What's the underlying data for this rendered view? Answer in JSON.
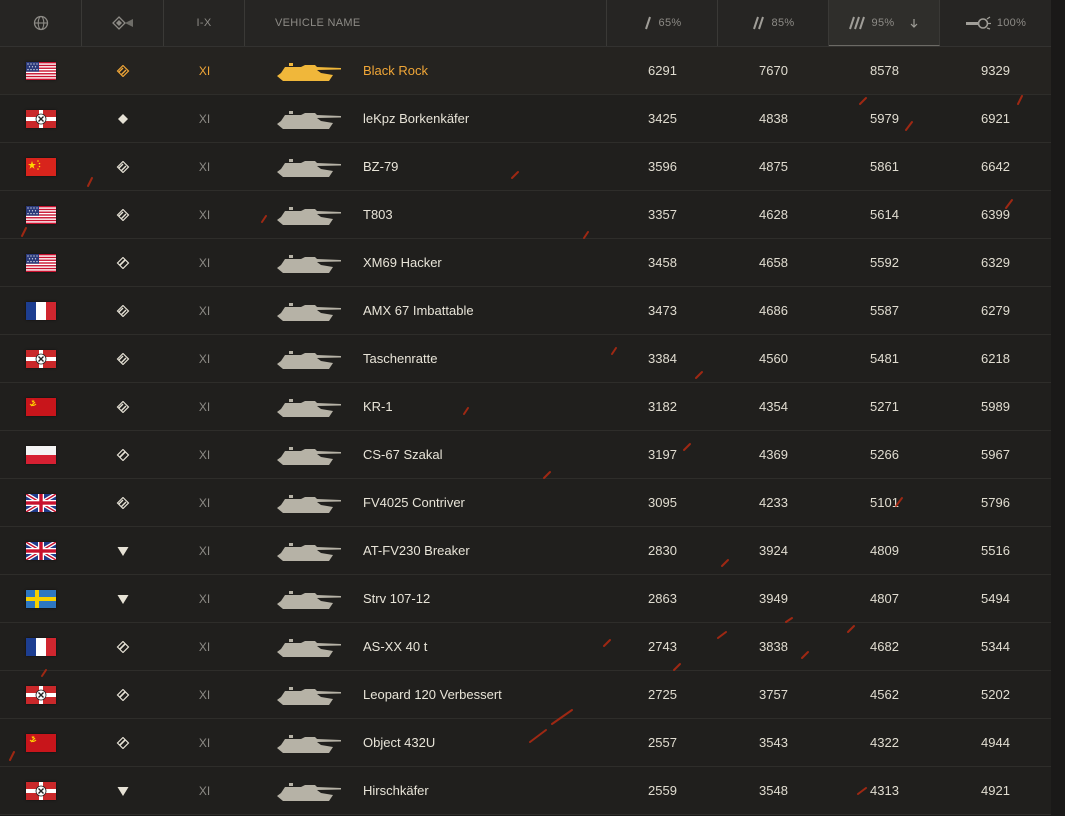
{
  "header": {
    "col_nation": "nation-globe-icon",
    "col_class": "vehicle-class-icon",
    "col_tier": "I-X",
    "col_name": "VEHICLE NAME",
    "col_m1": "65%",
    "col_m2": "85%",
    "col_m3": "95%",
    "col_m3_sort": "sort-down-arrow-icon",
    "col_m4": "100%"
  },
  "colors": {
    "accent": "#f0a637",
    "text": "#e8e4d8",
    "muted": "#8d8b86",
    "background": "#1a1918"
  },
  "rows": [
    {
      "nation": "usa",
      "cls": "heavy",
      "tier": "XI",
      "name": "Black Rock",
      "m1": "6291",
      "m2": "7670",
      "m3": "8578",
      "m4": "9329",
      "fav": true
    },
    {
      "nation": "germany",
      "cls": "light",
      "tier": "XI",
      "name": "leKpz Borkenkäfer",
      "m1": "3425",
      "m2": "4838",
      "m3": "5979",
      "m4": "6921"
    },
    {
      "nation": "china",
      "cls": "heavy",
      "tier": "XI",
      "name": "BZ-79",
      "m1": "3596",
      "m2": "4875",
      "m3": "5861",
      "m4": "6642"
    },
    {
      "nation": "usa",
      "cls": "heavy",
      "tier": "XI",
      "name": "T803",
      "m1": "3357",
      "m2": "4628",
      "m3": "5614",
      "m4": "6399"
    },
    {
      "nation": "usa",
      "cls": "medium",
      "tier": "XI",
      "name": "XM69 Hacker",
      "m1": "3458",
      "m2": "4658",
      "m3": "5592",
      "m4": "6329"
    },
    {
      "nation": "france",
      "cls": "heavy",
      "tier": "XI",
      "name": "AMX 67 Imbattable",
      "m1": "3473",
      "m2": "4686",
      "m3": "5587",
      "m4": "6279"
    },
    {
      "nation": "germany",
      "cls": "heavy",
      "tier": "XI",
      "name": "Taschenratte",
      "m1": "3384",
      "m2": "4560",
      "m3": "5481",
      "m4": "6218"
    },
    {
      "nation": "ussr",
      "cls": "heavy",
      "tier": "XI",
      "name": "KR-1",
      "m1": "3182",
      "m2": "4354",
      "m3": "5271",
      "m4": "5989"
    },
    {
      "nation": "poland",
      "cls": "medium",
      "tier": "XI",
      "name": "CS-67 Szakal",
      "m1": "3197",
      "m2": "4369",
      "m3": "5266",
      "m4": "5967"
    },
    {
      "nation": "uk",
      "cls": "heavy",
      "tier": "XI",
      "name": "FV4025 Contriver",
      "m1": "3095",
      "m2": "4233",
      "m3": "5101",
      "m4": "5796"
    },
    {
      "nation": "uk",
      "cls": "td",
      "tier": "XI",
      "name": "AT-FV230 Breaker",
      "m1": "2830",
      "m2": "3924",
      "m3": "4809",
      "m4": "5516"
    },
    {
      "nation": "sweden",
      "cls": "td",
      "tier": "XI",
      "name": "Strv 107-12",
      "m1": "2863",
      "m2": "3949",
      "m3": "4807",
      "m4": "5494"
    },
    {
      "nation": "france",
      "cls": "medium",
      "tier": "XI",
      "name": "AS-XX 40 t",
      "m1": "2743",
      "m2": "3838",
      "m3": "4682",
      "m4": "5344"
    },
    {
      "nation": "germany",
      "cls": "medium",
      "tier": "XI",
      "name": "Leopard 120 Verbessert",
      "m1": "2725",
      "m2": "3757",
      "m3": "4562",
      "m4": "5202"
    },
    {
      "nation": "ussr",
      "cls": "medium",
      "tier": "XI",
      "name": "Object 432U",
      "m1": "2557",
      "m2": "3543",
      "m3": "4322",
      "m4": "4944"
    },
    {
      "nation": "germany",
      "cls": "td",
      "tier": "XI",
      "name": "Hirschkäfer",
      "m1": "2559",
      "m2": "3548",
      "m3": "4313",
      "m4": "4921"
    }
  ]
}
